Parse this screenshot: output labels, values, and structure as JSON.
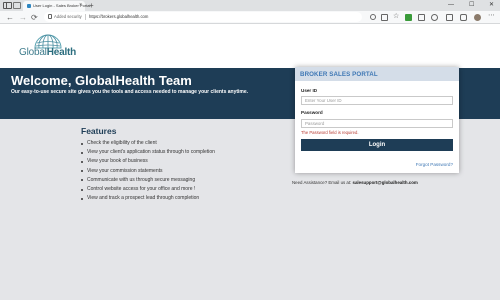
{
  "browser": {
    "tab_title": "User Login - Sales Broker Portal",
    "tab_close": "×",
    "new_tab": "+",
    "controls": {
      "minimize": "—",
      "maximize": "☐",
      "close": "✕"
    },
    "nav": {
      "back": "←",
      "forward": "→",
      "reload": "⟳"
    },
    "secure_label": "Added security",
    "url": "https://brokers.globalhealth.com",
    "toolbar_icons": [
      "read-aloud-icon",
      "zoom-icon",
      "favorite-star-icon",
      "extension-green-icon",
      "extension-icon",
      "refresh-extension-icon",
      "collections-icon",
      "sync-icon",
      "profile-avatar-icon"
    ]
  },
  "logo": {
    "part1": "Global",
    "part2": "Health"
  },
  "hero": {
    "title": "Welcome, GlobalHealth Team",
    "subtitle": "Our easy-to-use secure site gives you the tools and access needed to manage your clients anytime."
  },
  "features": {
    "title": "Features",
    "items": [
      "Check the eligibility of the client",
      "View your client's application status through to completion",
      "View your book of business",
      "View your commission statements",
      "Communicate with us through secure messaging",
      "Control website access for your office and more !",
      "View and track a prospect lead through completion"
    ]
  },
  "assistance": {
    "prefix": "Need Assistance? Email us at:",
    "email": "salesupport@globalhealth.com"
  },
  "login": {
    "title": "BROKER SALES PORTAL",
    "user_id_label": "User ID",
    "user_id_placeholder": "Enter Your User ID",
    "password_label": "Password",
    "password_placeholder": "Password",
    "error": "The Password field is required.",
    "button": "Login",
    "forgot": "Forgot Password?"
  },
  "colors": {
    "navy": "#1e3d56",
    "accent_blue": "#3f78b5",
    "teal": "#3f7c8c",
    "error_red": "#b73b32",
    "page_gray": "#e4e5e8"
  }
}
